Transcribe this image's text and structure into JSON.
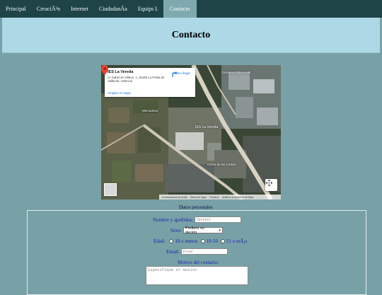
{
  "nav": {
    "items": [
      {
        "label": "Principal"
      },
      {
        "label": "CreaciÃ³n"
      },
      {
        "label": "Internet"
      },
      {
        "label": "CiudadanÃ­a"
      },
      {
        "label": "Equips I."
      },
      {
        "label": "Contacto",
        "active": true
      }
    ]
  },
  "header": {
    "title": "Contacto"
  },
  "map": {
    "place_name": "IES La Vereda",
    "address": "C/ Isabel de Villena, 1, 46185 La Pobla de Vallbona, Valencia",
    "directions_label": "Cómo llegar",
    "enlarge_link": "Ampliar el mapa",
    "pin_label": "IES La Vereda",
    "area_labels": {
      "north": "Carretera Ribera Alta",
      "west": "Mercadona",
      "south": "Carrer de les Costes"
    },
    "footer": {
      "shortcuts": "Combinaciones de teclas",
      "map_data": "Datos del mapa",
      "terms": "Términos",
      "report": "Notificar un problema de Maps"
    }
  },
  "form": {
    "legend": "Datos personales",
    "name_label": "Nombre y apellidos:",
    "name_placeholder": "Nombre",
    "sex_label": "Sexo:",
    "sex_selected": "Prefiero no decirlo",
    "age_label": "Edad:",
    "age_options": [
      "18 o menos",
      "19-50",
      "51 o mÃ¡s"
    ],
    "email_label": "Email:",
    "email_placeholder": "Email",
    "reason_label": "Motivo del contacto:",
    "reason_placeholder": "Especifique el motivo"
  }
}
